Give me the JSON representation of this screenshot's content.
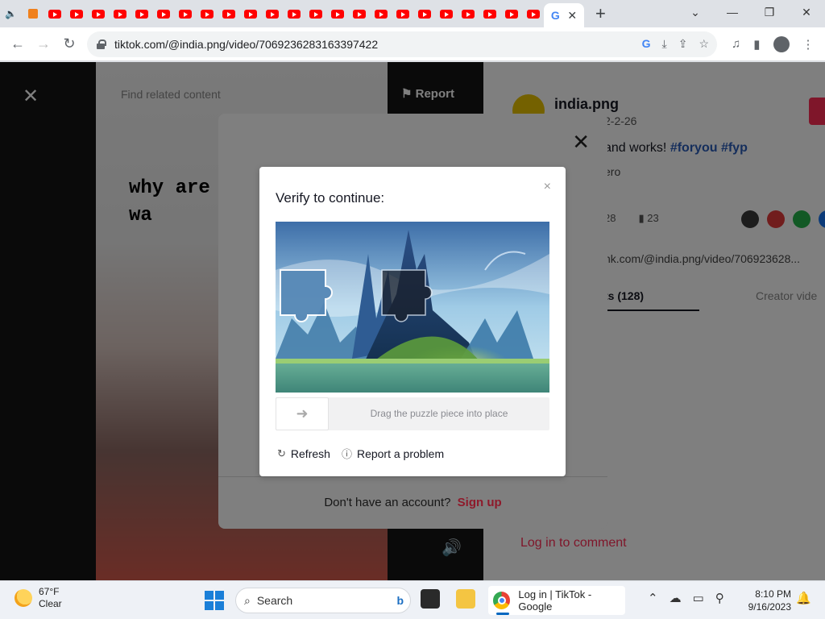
{
  "browser": {
    "active_tab_close": "✕",
    "new_tab": "+",
    "url": "tiktok.com/@india.png/video/7069236283163397422",
    "window_controls": {
      "dropdown": "⌄",
      "minimize": "—",
      "restore": "❐",
      "close": "✕"
    }
  },
  "video": {
    "caption": "why are\nwa",
    "search_placeholder": "Find related content",
    "report_label": "Report"
  },
  "side": {
    "author": "india.png",
    "date": "2-2-26",
    "description": "and works!",
    "hashtags": [
      "#foryou",
      "#fyp"
    ],
    "music": "ero",
    "comments_count": "28",
    "bookmarks_count": "23",
    "link": "nk.com/@india.png/video/706923628...",
    "tab_comments": "ts (128)",
    "tab_creator": "Creator vide",
    "login_to_comment": "Log in to comment"
  },
  "login_modal": {
    "close": "✕",
    "footer_text": "Don't have an account?",
    "signup": "Sign up"
  },
  "captcha": {
    "title": "Verify to continue:",
    "close": "×",
    "slider_hint": "Drag the puzzle piece into place",
    "refresh": "Refresh",
    "report": "Report a problem"
  },
  "taskbar": {
    "weather_temp": "67°F",
    "weather_cond": "Clear",
    "search": "Search",
    "chrome_title": "Log in | TikTok - Google",
    "time": "8:10 PM",
    "date": "9/16/2023"
  },
  "colors": {
    "accent": "#fe2c55",
    "hashtag": "#2b5db9",
    "overlay": "rgba(0,0,0,0.5)"
  }
}
